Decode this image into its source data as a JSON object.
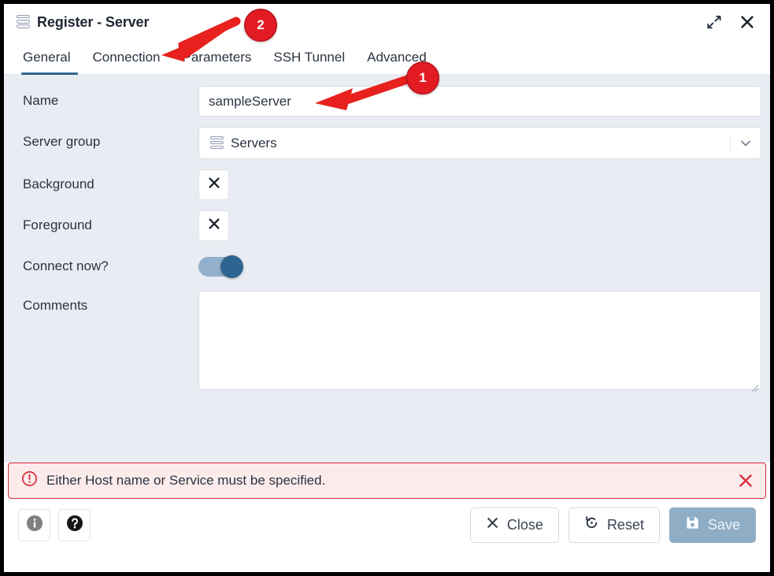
{
  "window": {
    "title": "Register - Server",
    "icon": "server-stack-icon",
    "maximize_icon": "expand-diagonal-icon",
    "close_icon": "close-icon"
  },
  "tabs": [
    {
      "label": "General",
      "active": true
    },
    {
      "label": "Connection",
      "active": false
    },
    {
      "label": "Parameters",
      "active": false
    },
    {
      "label": "SSH Tunnel",
      "active": false
    },
    {
      "label": "Advanced",
      "active": false
    }
  ],
  "form": {
    "name": {
      "label": "Name",
      "value": "sampleServer",
      "placeholder": ""
    },
    "server_group": {
      "label": "Server group",
      "value": "Servers",
      "icon": "server-stack-icon",
      "chevron": "chevron-down-icon"
    },
    "background": {
      "label": "Background",
      "button_icon": "close-x-icon"
    },
    "foreground": {
      "label": "Foreground",
      "button_icon": "close-x-icon"
    },
    "connect_now": {
      "label": "Connect now?",
      "checked": true
    },
    "comments": {
      "label": "Comments",
      "value": "",
      "placeholder": ""
    }
  },
  "error": {
    "icon": "alert-circle-icon",
    "message": "Either Host name or Service must be specified.",
    "dismiss_icon": "close-icon"
  },
  "footer": {
    "info_button": {
      "label": "",
      "icon": "info-circle-icon"
    },
    "help_button": {
      "label": "",
      "icon": "help-circle-icon"
    },
    "close_button": {
      "label": "Close",
      "icon": "close-x-icon"
    },
    "reset_button": {
      "label": "Reset",
      "icon": "reset-circle-arrow-icon"
    },
    "save_button": {
      "label": "Save",
      "icon": "save-floppy-icon",
      "disabled": true
    }
  },
  "annotations": [
    {
      "number": "1",
      "target": "name-input",
      "arrow": "points-left"
    },
    {
      "number": "2",
      "target": "tab-connection",
      "arrow": "points-down-left"
    }
  ],
  "colors": {
    "accent": "#326690",
    "form_bg": "#e9ecf2",
    "error_border": "#d9293a",
    "error_bg": "#fcebeb",
    "annotation_red": "#e31c24",
    "toggle_track": "#92b0cb",
    "toggle_knob": "#2e6490",
    "save_disabled": "#8fadc5"
  }
}
